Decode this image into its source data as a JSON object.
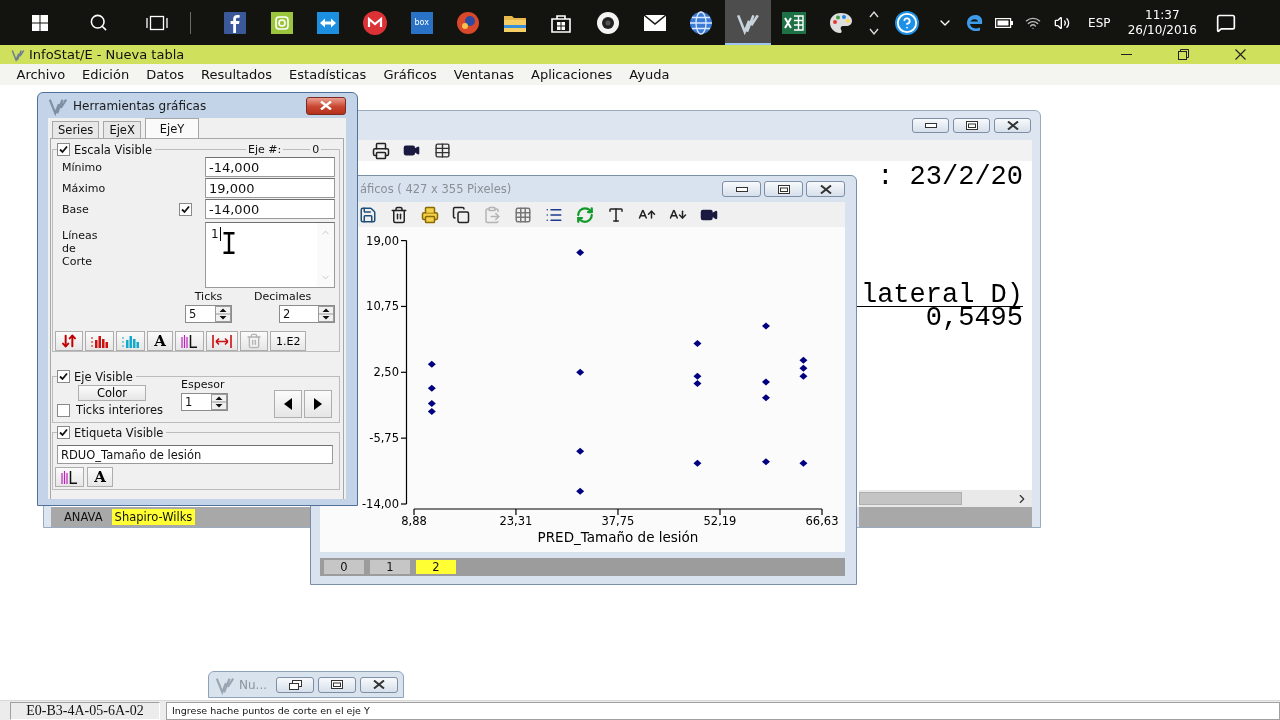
{
  "taskbar": {
    "apps": [
      {
        "kind": "facebook",
        "active": false
      },
      {
        "kind": "camera",
        "active": false
      },
      {
        "kind": "arrows",
        "active": false
      },
      {
        "kind": "gmail",
        "active": false
      },
      {
        "kind": "box",
        "label": "box",
        "active": false
      },
      {
        "kind": "orb",
        "active": false
      },
      {
        "kind": "folder",
        "active": false
      },
      {
        "kind": "store",
        "active": false
      },
      {
        "kind": "webcam",
        "active": false
      },
      {
        "kind": "mail",
        "active": false
      },
      {
        "kind": "globe",
        "active": false
      },
      {
        "kind": "infostat",
        "active": true
      },
      {
        "kind": "excel",
        "active": false
      },
      {
        "kind": "paint",
        "active": false
      }
    ],
    "language": "ESP",
    "time": "11:37",
    "date": "26/10/2016"
  },
  "window": {
    "title": "InfoStat/E - Nueva tabla"
  },
  "menu": [
    "Archivo",
    "Edición",
    "Datos",
    "Resultados",
    "Estadísticas",
    "Gráficos",
    "Ventanas",
    "Aplicaciones",
    "Ayuda"
  ],
  "results_window": {
    "header": ": 23/2/20",
    "table": {
      "columns": [
        "lateral D)"
      ],
      "rows": [
        [
          "0,5495"
        ]
      ]
    },
    "tabs": [
      {
        "label": "ANAVA",
        "selected": false
      },
      {
        "label": "Shapiro-Wilks",
        "selected": true
      }
    ]
  },
  "graph_window": {
    "title": "áficos ( 427 x 355 Pixeles)",
    "toolbar": [
      {
        "kind": "save",
        "disabled": false
      },
      {
        "kind": "delete",
        "disabled": false
      },
      {
        "kind": "print-preview",
        "disabled": false
      },
      {
        "kind": "copy",
        "disabled": false
      },
      {
        "kind": "paste",
        "disabled": true
      },
      {
        "kind": "grid",
        "disabled": false
      },
      {
        "kind": "legend",
        "disabled": false
      },
      {
        "kind": "refresh",
        "disabled": false
      },
      {
        "kind": "text",
        "disabled": false
      },
      {
        "kind": "font-larger",
        "disabled": false
      },
      {
        "kind": "font-smaller",
        "disabled": false
      },
      {
        "kind": "exit",
        "disabled": false
      }
    ],
    "chart_data": {
      "type": "scatter",
      "xlabel": "PRED_Tamaño de lesión",
      "x": [
        11.4,
        11.4,
        11.4,
        11.4,
        32.4,
        32.4,
        32.4,
        32.4,
        49,
        49,
        49,
        49,
        58.7,
        58.7,
        58.7,
        58.7,
        64,
        64,
        64,
        64
      ],
      "values": [
        3.5,
        0.5,
        -1.4,
        -2.4,
        17.5,
        2.5,
        -7.4,
        -12.4,
        6.1,
        2,
        1.1,
        -8.9,
        8.3,
        1.3,
        -0.7,
        -8.7,
        4,
        3,
        2,
        -8.9
      ],
      "xlim": [
        8.88,
        66.63
      ],
      "ylim": [
        -14,
        19
      ],
      "xticks": [
        {
          "value": 8.88,
          "label": "8,88"
        },
        {
          "value": 23.31,
          "label": "23,31"
        },
        {
          "value": 37.75,
          "label": "37,75"
        },
        {
          "value": 52.19,
          "label": "52,19"
        },
        {
          "value": 66.63,
          "label": "66,63"
        }
      ],
      "yticks": [
        {
          "value": -14,
          "label": "-14,00"
        },
        {
          "value": -5.75,
          "label": "-5,75"
        },
        {
          "value": 2.5,
          "label": "2,50"
        },
        {
          "value": 10.75,
          "label": "10,75"
        },
        {
          "value": 19,
          "label": "19,00"
        }
      ]
    },
    "tabs": [
      {
        "label": "0",
        "selected": false
      },
      {
        "label": "1",
        "selected": false
      },
      {
        "label": "2",
        "selected": true
      }
    ]
  },
  "tools_window": {
    "title": "Herramientas gráficas",
    "tabs": [
      {
        "label": "Series",
        "selected": false
      },
      {
        "label": "EjeX",
        "selected": false
      },
      {
        "label": "EjeY",
        "selected": true
      }
    ],
    "scale": {
      "label": "Escala Visible",
      "checked": true,
      "axis_caption": "Eje #:",
      "axis_number": "0",
      "fields": [
        {
          "label": "Mínimo",
          "value": "-14,000"
        },
        {
          "label": "Máximo",
          "value": "19,000"
        }
      ],
      "base": {
        "label": "Base",
        "value": "-14,000",
        "checked": true
      },
      "cut_lines": {
        "label": "Líneas de Corte",
        "value": "1"
      },
      "ticks": {
        "label": "Ticks",
        "value": "5"
      },
      "decimals": {
        "label": "Decimales",
        "value": "2"
      }
    },
    "tool_buttons": [
      {
        "kind": "swap",
        "disabled": false
      },
      {
        "kind": "bars",
        "color": "#cc1111",
        "disabled": false
      },
      {
        "kind": "bars",
        "color": "#11aacc",
        "disabled": false
      },
      {
        "kind": "font",
        "label": "A",
        "disabled": false
      },
      {
        "kind": "label",
        "disabled": false
      },
      {
        "kind": "spacing",
        "disabled": false
      },
      {
        "kind": "delete",
        "disabled": true
      },
      {
        "kind": "scientific",
        "label": "1.E2",
        "disabled": false
      }
    ],
    "axis": {
      "label": "Eje Visible",
      "checked": true,
      "color_button": "Color",
      "inner_ticks": {
        "label": "Ticks interiores",
        "checked": false
      },
      "thickness": {
        "label": "Espesor",
        "value": "1"
      }
    },
    "axis_label": {
      "label": "Etiqueta Visible",
      "checked": true,
      "value": "RDUO_Tamaño de lesión",
      "buttons": [
        {
          "kind": "label"
        },
        {
          "kind": "font",
          "label": "A"
        }
      ]
    }
  },
  "minimized_window": {
    "title": "Nu..."
  },
  "status_bar": {
    "code": "E0-B3-4A-05-6A-02",
    "message": "Ingrese hache puntos de corte en el eje Y"
  }
}
